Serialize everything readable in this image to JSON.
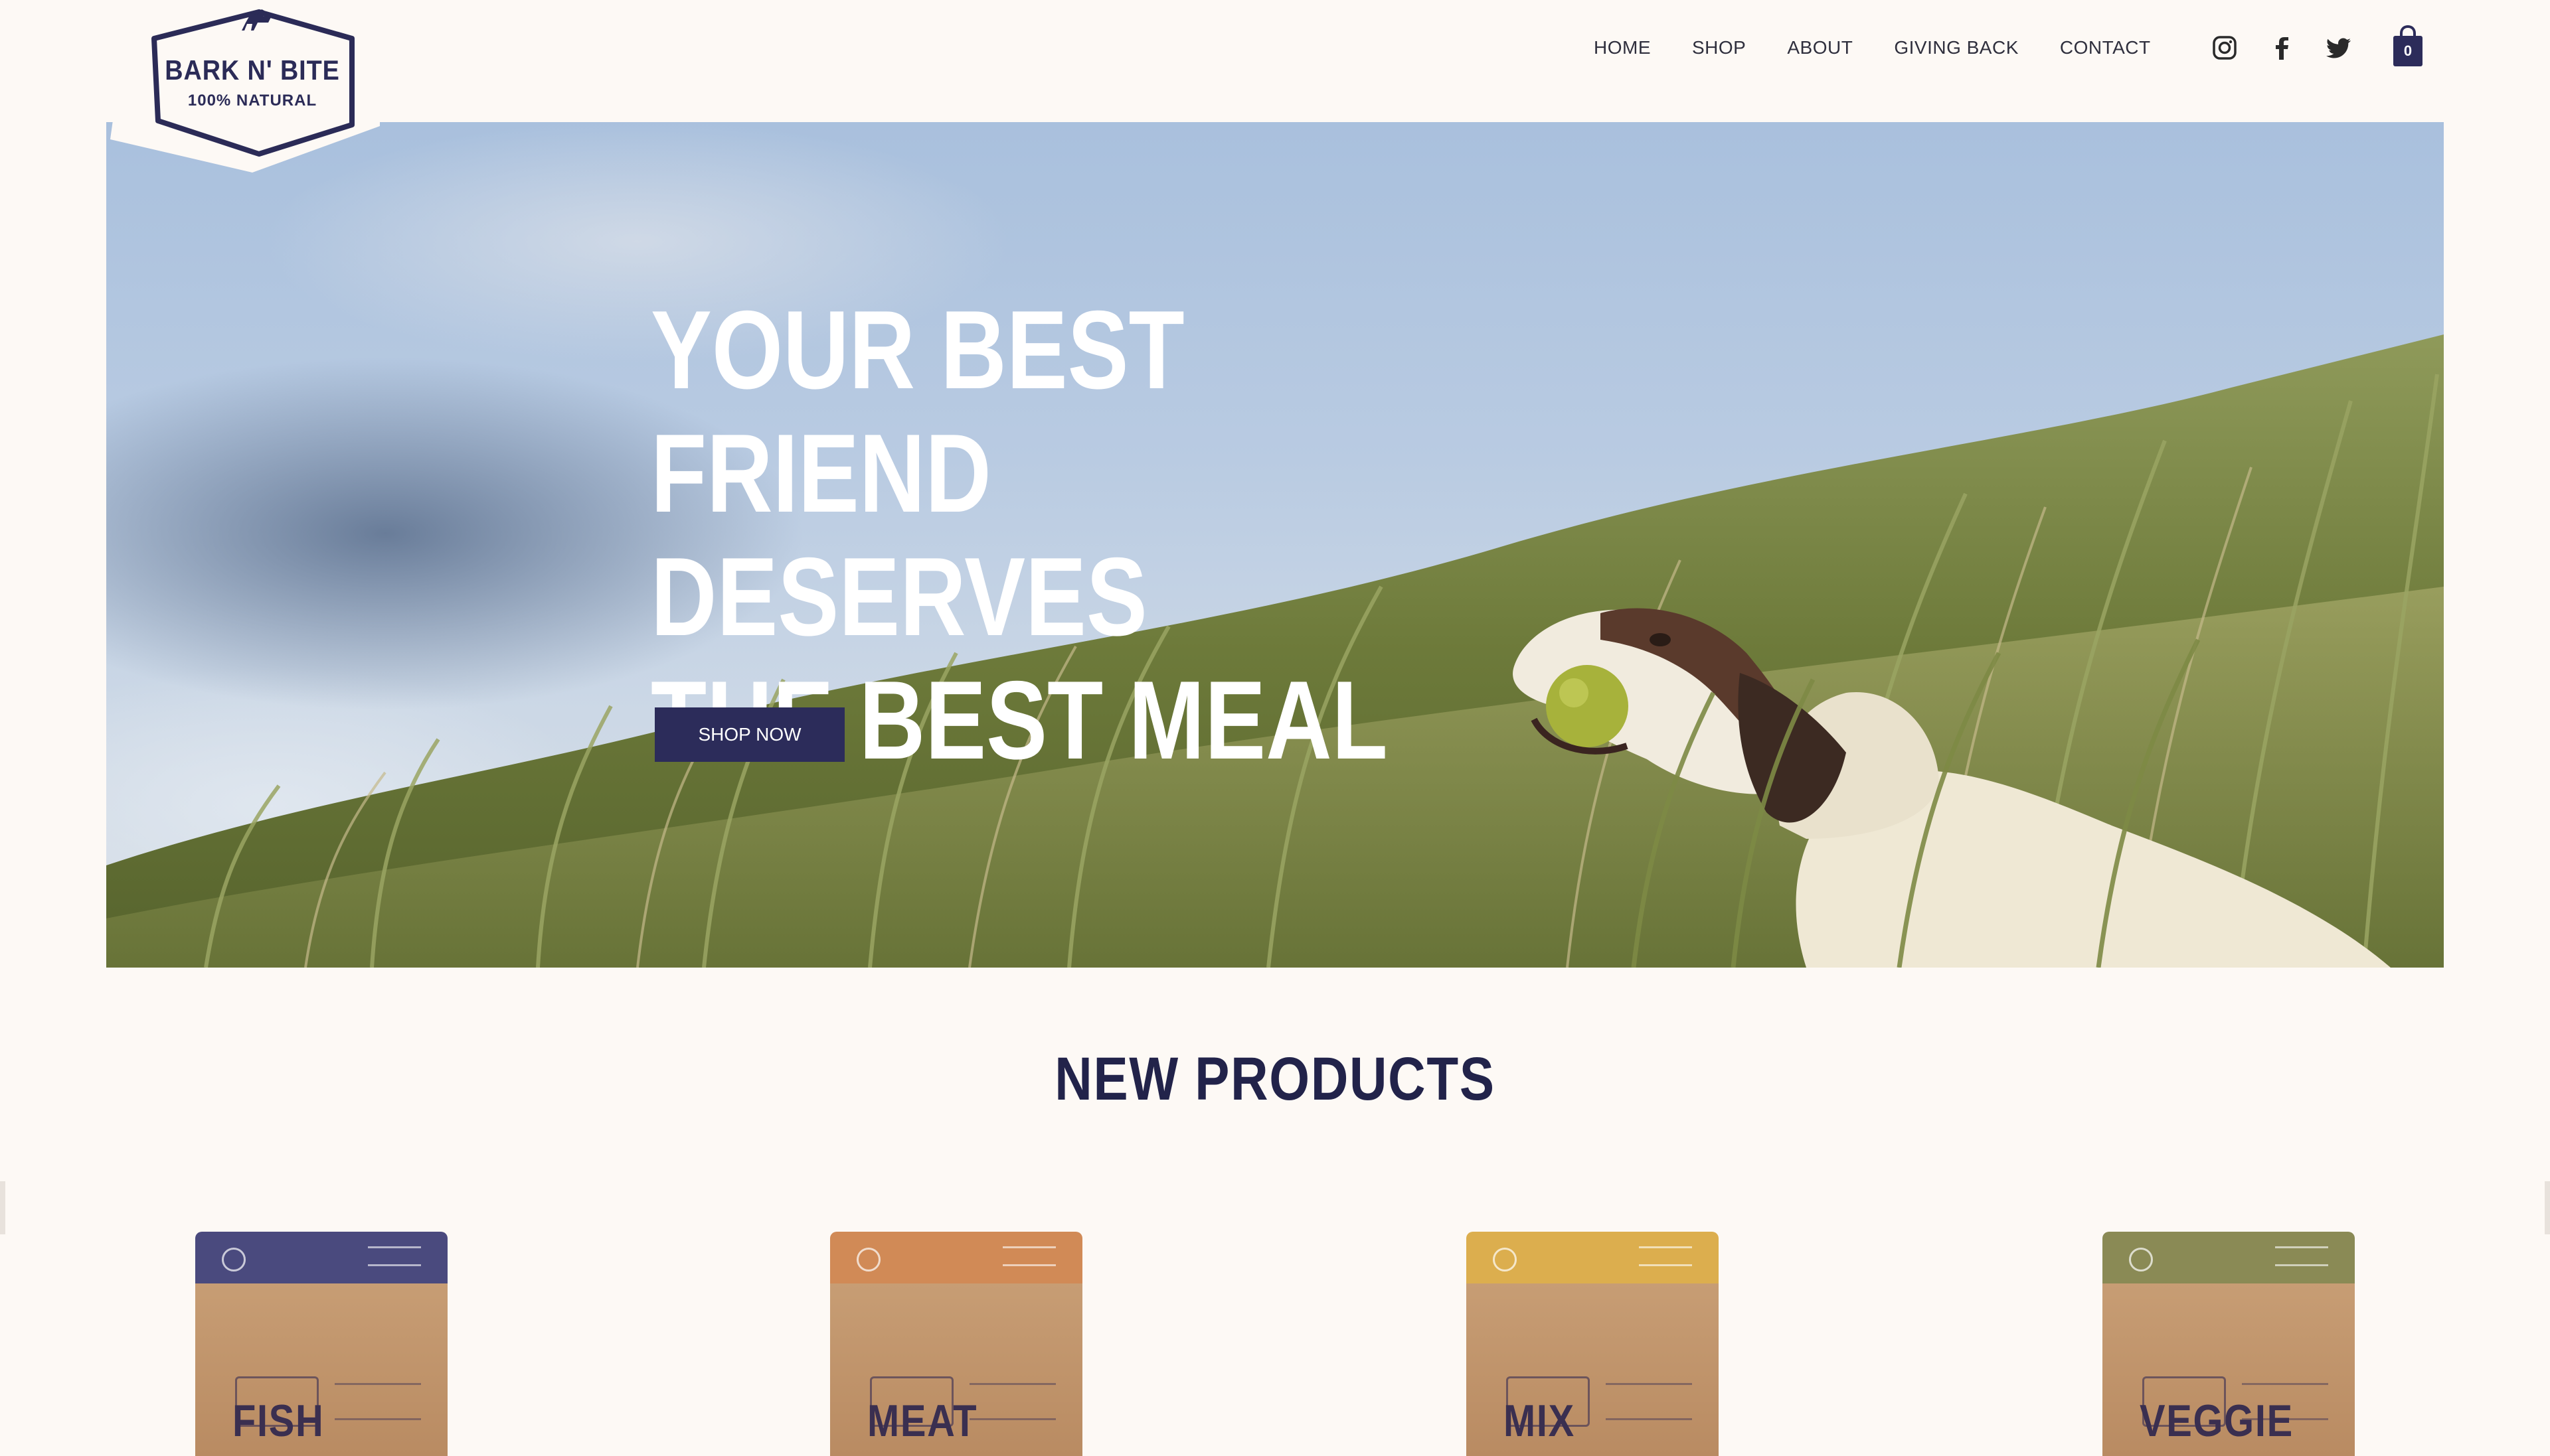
{
  "brand": {
    "name": "BARK N' BITE",
    "tagline": "100% NATURAL"
  },
  "nav": {
    "items": [
      "HOME",
      "SHOP",
      "ABOUT",
      "GIVING BACK",
      "CONTACT"
    ]
  },
  "social": {
    "icons": [
      "instagram-icon",
      "facebook-icon",
      "twitter-icon"
    ]
  },
  "cart": {
    "count": "0"
  },
  "hero": {
    "lines": [
      "YOUR BEST",
      "FRIEND DESERVES",
      "THE BEST MEAL"
    ],
    "cta_label": "SHOP NOW"
  },
  "products_section": {
    "title": "NEW PRODUCTS",
    "items": [
      {
        "name": "FISH",
        "color": "#4a4a7e"
      },
      {
        "name": "MEAT",
        "color": "#d18a56"
      },
      {
        "name": "MIX",
        "color": "#dcae4e"
      },
      {
        "name": "VEGGIE",
        "color": "#8a8a55"
      }
    ]
  },
  "colors": {
    "background": "#fdf9f5",
    "navy": "#2c2c5a"
  }
}
